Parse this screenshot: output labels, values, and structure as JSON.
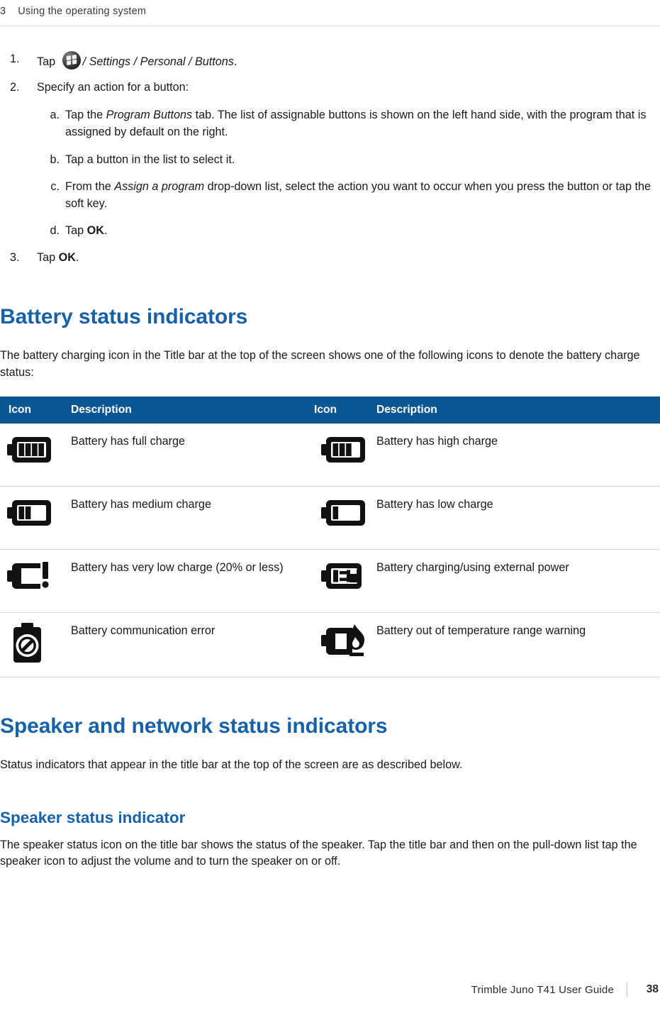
{
  "header": {
    "chapter_number": "3",
    "chapter_title": "Using the  operating system"
  },
  "steps": [
    {
      "marker": "1.",
      "prefix": "Tap ",
      "icon": "windows-start-orb-icon",
      "path_text": "/ Settings / Personal / Buttons",
      "suffix": "."
    },
    {
      "marker": "2.",
      "text": "Specify an action for a button:",
      "substeps": [
        {
          "marker": "a.",
          "pre": "Tap the ",
          "em": "Program Buttons",
          "post": " tab. The list of assignable buttons is shown on the left hand side, with the program that is assigned by default on the right."
        },
        {
          "marker": "b.",
          "pre": "Tap a button in the list to select it.",
          "em": "",
          "post": ""
        },
        {
          "marker": "c.",
          "pre": "From the ",
          "em": "Assign a program",
          "post": " drop-down list, select the action you want to occur when you press the button or tap the soft key."
        },
        {
          "marker": "d.",
          "pre": "Tap ",
          "strong": "OK",
          "post": "."
        }
      ]
    },
    {
      "marker": "3.",
      "pre": "Tap ",
      "strong": "OK",
      "post": "."
    }
  ],
  "battery_section": {
    "heading": "Battery status indicators",
    "intro": "The battery charging icon in the Title bar at the top of the screen shows one of the following icons to denote the battery charge status:",
    "table": {
      "headers": [
        "Icon",
        "Description",
        "Icon",
        "Description"
      ],
      "rows": [
        {
          "left_icon": "battery-full-icon",
          "left_desc": "Battery has full charge",
          "right_icon": "battery-high-icon",
          "right_desc": "Battery has high charge"
        },
        {
          "left_icon": "battery-medium-icon",
          "left_desc": "Battery has medium charge",
          "right_icon": "battery-low-icon",
          "right_desc": "Battery has low charge"
        },
        {
          "left_icon": "battery-very-low-icon",
          "left_desc": "Battery has very low charge (20% or less)",
          "right_icon": "battery-charging-icon",
          "right_desc": "Battery charging/using external power"
        },
        {
          "left_icon": "battery-comm-error-icon",
          "left_desc": "Battery communication error",
          "right_icon": "battery-temperature-warning-icon",
          "right_desc": "Battery out of temperature range warning"
        }
      ]
    }
  },
  "speaker_section": {
    "heading": "Speaker and network status indicators",
    "intro": "Status indicators that appear in the title bar at the top of the screen are as described below.",
    "subheading": "Speaker status indicator",
    "body": "The speaker status icon on the title bar shows the status of the speaker. Tap the title bar and then on the pull-down list tap the speaker icon to adjust the volume and to turn the speaker on or off."
  },
  "footer": {
    "guide_title": "Trimble Juno T41 User Guide",
    "page_number": "38"
  },
  "colors": {
    "heading_blue": "#1761a8",
    "table_header_blue": "#0a5693",
    "rule_light_blue": "#c5d9e8"
  }
}
